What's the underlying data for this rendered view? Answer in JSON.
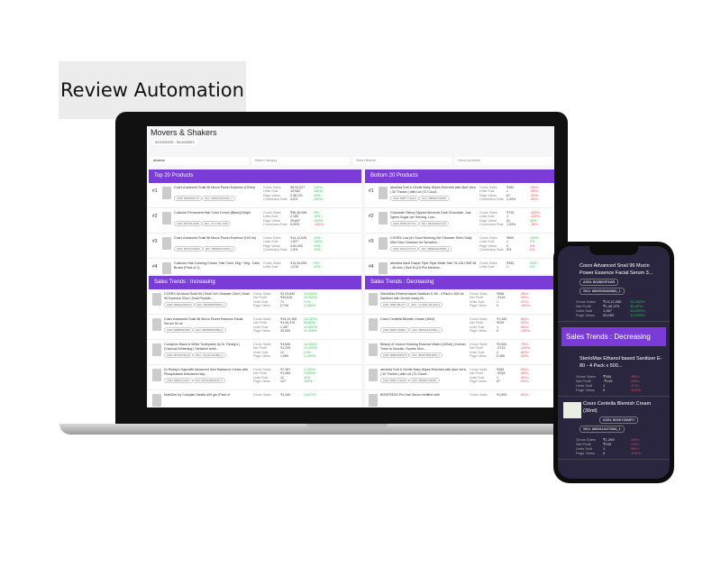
{
  "label": "Review Automation",
  "dashboard": {
    "title": "Movers & Shakers",
    "date_range": "02/10/2023 - 31/10/2023",
    "filters": [
      {
        "caption": "Select Marketplace",
        "value": "Amazon"
      },
      {
        "value": "Select Category"
      },
      {
        "value": "Select Brands"
      },
      {
        "value": "Search products"
      }
    ],
    "panels": [
      {
        "title": "Top 20 Products",
        "ranked": true,
        "rows": [
          {
            "rank": "#1",
            "name": "Cosrx Advanced Snail 96 Mucin Power Essence (100ml)",
            "asin": "ASIN: B00PBX3L7K",
            "sku": "SKU: 8809416470009_1",
            "metrics": [
              [
                "Gross Sales",
                "₹5,93,027",
                "100%↑",
                "up"
              ],
              [
                "Units Sold",
                "10,902",
                "100%↑",
                "up"
              ],
              [
                "Page Views",
                "2,38,101",
                "20%↑",
                "up"
              ],
              [
                "Conversion Rate",
                "4.5%",
                "100%↑",
                "up"
              ]
            ]
          },
          {
            "rank": "#2",
            "name": "Cuticolor Permanent Hair Color Cream (Black)100gm",
            "asin": "ASIN: B07K5L3P46",
            "sku": "SKU: VT-A7SE-Y5PT",
            "metrics": [
              [
                "Gross Sales",
                "₹36,46,998",
                "9%↑",
                "up"
              ],
              [
                "Units Sold",
                "2,169",
                "10%↑",
                "up"
              ],
              [
                "Page Views",
                "39,607",
                "100%↑",
                "up"
              ],
              [
                "Conversion Rate",
                "5.05%",
                "-100%↓",
                "dn"
              ]
            ]
          },
          {
            "rank": "#3",
            "name": "Cosrx Advanced Snail 96 Mucin Power Essence (100 ml)",
            "asin": "ASIN: B07K1G4RD9",
            "sku": "SKU: 8809416470009_1",
            "metrics": [
              [
                "Gross Sales",
                "₹14,12,626",
                "10%↑",
                "up"
              ],
              [
                "Units Sold",
                "1,627",
                "100%↑",
                "up"
              ],
              [
                "Page Views",
                "4,00,000",
                "10%↑",
                "up"
              ],
              [
                "Conversion Rate",
                "1.5%",
                "10%↑",
                "up"
              ]
            ]
          },
          {
            "rank": "#4",
            "name": "Cuticolor Hair Coloring Cream, Hair Color, 60g + 60g - Dark Brown (Pack of 1)",
            "asin": "",
            "sku": "",
            "metrics": [
              [
                "Gross Sales",
                "₹14,34,695",
                "2%↑",
                "up"
              ],
              [
                "Units Sold",
                "1,216",
                "10%↑",
                "up"
              ]
            ]
          }
        ]
      },
      {
        "title": "Bottom 20 Products",
        "ranked": true,
        "rows": [
          {
            "rank": "#1",
            "name": "abrorbia Soft & Gentle Baby Wipes Enriched with Aloe Vera | 3X Thicker | with Lid (72 Count...",
            "asin": "ASIN: B08TYC1HKC",
            "sku": "SKU: 8809537006361",
            "metrics": [
              [
                "Gross Sales",
                "₹450",
                "-99%↓",
                "dn"
              ],
              [
                "Units Sold",
                "1",
                "-99%↓",
                "dn"
              ],
              [
                "Page Views",
                "67",
                "-93%↓",
                "dn"
              ],
              [
                "Conversion Rate",
                "1.49%",
                "-99%↓",
                "dn"
              ]
            ]
          },
          {
            "rank": "#2",
            "name": "Chocolate Skinny Dipped Almonds Dark Chocolate, Just 2grms Sugar per Serving, Low...",
            "asin": "ASIN: B09FCP7V9G",
            "sku": "SKU: 8904400157247",
            "metrics": [
              [
                "Gross Sales",
                "₹725",
                "-100%↓",
                "dn"
              ],
              [
                "Units Sold",
                "1",
                "-100%↓",
                "dn"
              ],
              [
                "Page Views",
                "61",
                "50%↑",
                "up"
              ],
              [
                "Conversion Rate",
                "1.63%",
                "-78%↓",
                "dn"
              ]
            ]
          },
          {
            "rank": "#3",
            "name": "COSRX Low pH Good Morning Gel Cleanser 50ml, Daily Mild Face Cleanser for Sensitive...",
            "asin": "ASIN: B01CS7Y9YA",
            "sku": "SKU: 8809416470528_1",
            "metrics": [
              [
                "Gross Sales",
                "₹600",
                "100%↑",
                "up"
              ],
              [
                "Units Sold",
                "1",
                "0%",
                "up"
              ],
              [
                "Page Views",
                "0",
                "0%",
                "dn"
              ],
              [
                "Conversion Rate",
                "0%",
                "0%",
                "dn"
              ]
            ]
          },
          {
            "rank": "#4",
            "name": "abrorbia Adult Diaper Tape Style Waist Size 75-115 CMS 28 - 46 inns | Size M (10 Pcs Medium...",
            "asin": "",
            "sku": "",
            "metrics": [
              [
                "Gross Sales",
                "₹363",
                "25%↑",
                "up"
              ],
              [
                "Units Sold",
                "1",
                "0%",
                "up"
              ]
            ]
          }
        ]
      },
      {
        "title": "Sales Trends : Increasing",
        "ranked": false,
        "rows": [
          {
            "name": "COSRX All About Snail Kit | Snail Gel Cleanser 20ml | Snail 96 Essence 30ml | Snail Peptide...",
            "asin": "ASIN: B08QHMWF3Q",
            "sku": "SKU: 8809598452800_1",
            "metrics": [
              [
                "Gross Sales",
                "₹2,33,640",
                "10,000%↑",
                "up"
              ],
              [
                "Net Profit",
                "₹39,816",
                "10,000%↑",
                "up"
              ],
              [
                "Units Sold",
                "71",
                "71%↑",
                "up"
              ],
              [
                "Page Views",
                "2,749",
                "2,166%↑",
                "up"
              ]
            ]
          },
          {
            "name": "Cosrx Advanced Snail 96 Mucin Power Essence Facial Serum 30 ml",
            "asin": "ASIN: B00B5SP4W5",
            "sku": "SKU: 8809598453580_1",
            "metrics": [
              [
                "Gross Sales",
                "₹15,12,455",
                "15,232%↑",
                "up"
              ],
              [
                "Net Profit",
                "₹1,40,375",
                "95.82%↑",
                "up"
              ],
              [
                "Units Sold",
                "1,387",
                "10,000%↑",
                "up"
              ],
              [
                "Page Views",
                "30,053",
                "11,009%↑",
                "up"
              ]
            ]
          },
          {
            "name": "Cunaprox Black Is White Toothpaste by Dr. Reddy's | Charcoal Whitening | Sensitive teeth...",
            "asin": "ASIN: B07SFG8QJH",
            "sku": "SKU: 7612412431802_1",
            "metrics": [
              [
                "Gross Sales",
                "₹3,690",
                "14,400%↑",
                "up"
              ],
              [
                "Net Profit",
                "₹1,209",
                "12,400%↑",
                "up"
              ],
              [
                "Units Sold",
                "12",
                "12%↑",
                "up"
              ],
              [
                "Page Views",
                "1,069",
                "1,100%↑",
                "up"
              ]
            ]
          },
          {
            "name": "Dr Reddy's Daprolife Advanced Skin Radiance Cream with Phosphatase Activators help...",
            "asin": "ASIN: B08F3CCZ6V",
            "sku": "SKU: 8901148030013_1",
            "metrics": [
              [
                "Gross Sales",
                "₹7,387",
                "1,100%↑",
                "up"
              ],
              [
                "Net Profit",
                "₹1,069",
                "2,000%↑",
                "up"
              ],
              [
                "Units Sold",
                "12",
                "11%↑",
                "up"
              ],
              [
                "Page Views",
                "107",
                "100%↑",
                "up"
              ]
            ]
          },
          {
            "name": "NutriGen by Compian Vanilla 400 gm (Pack of",
            "asin": "",
            "sku": "",
            "metrics": [
              [
                "Gross Sales",
                "₹3,440",
                "1,047%↑",
                "up"
              ]
            ]
          }
        ]
      },
      {
        "title": "Sales Trends : Decreasing",
        "ranked": false,
        "rows": [
          {
            "name": "SterloMax Ethanol based Sanitizer E-80 - 4 Pack x 500 ml Sanitizer with 2in1ee ready fill...",
            "asin": "ASIN: B08C7BHJ7Y",
            "sku": "SKU: VT-1800-000-500-4",
            "metrics": [
              [
                "Gross Sales",
                "₹556",
                "-98%↓",
                "dn"
              ],
              [
                "Net Profit",
                "-₹145",
                "-99%↓",
                "dn"
              ],
              [
                "Units Sold",
                "1",
                "-97%↓",
                "dn"
              ],
              [
                "Page Views",
                "0",
                "-100%↓",
                "dn"
              ]
            ]
          },
          {
            "name": "Cosrx Centella Blemish Cream (30ml)",
            "asin": "ASIN: B00KY00MRY",
            "sku": "SKU: 8809416470366_1",
            "metrics": [
              [
                "Gross Sales",
                "₹1,269",
                "-94%↓",
                "dn"
              ],
              [
                "Net Profit",
                "₹249",
                "-22%↓",
                "dn"
              ],
              [
                "Units Sold",
                "1",
                "-96%↓",
                "dn"
              ],
              [
                "Page Views",
                "0",
                "-100%↓",
                "dn"
              ]
            ]
          },
          {
            "name": "Beauty of Joseon Glowing Essence Water (100ml) | Korean Toner to Nourish, Soothe Skin...",
            "asin": "ASIN: B0B2SD6WT8",
            "sku": "SKU: 8809738316863_1",
            "metrics": [
              [
                "Gross Sales",
                "₹3,600",
                "-75%↓",
                "dn"
              ],
              [
                "Net Profit",
                "-₹743",
                "-100%↓",
                "dn"
              ],
              [
                "Units Sold",
                "2",
                "-80%↓",
                "dn"
              ],
              [
                "Page Views",
                "2,459",
                "-35%↓",
                "dn"
              ]
            ]
          },
          {
            "name": "abrorbia Soft & Gentle Baby Wipes Enriched with Aloe Vera | 3X Thicker | with Lid (72 Count...",
            "asin": "ASIN: B08TYC1HKC",
            "sku": "SKU: 8809537006361",
            "metrics": [
              [
                "Gross Sales",
                "₹365",
                "-99%↓",
                "dn"
              ],
              [
                "Net Profit",
                "-₹254",
                "-99%↓",
                "dn"
              ],
              [
                "Units Sold",
                "1",
                "-99%↓",
                "dn"
              ],
              [
                "Page Views",
                "67",
                "-93%↓",
                "dn"
              ]
            ]
          },
          {
            "name": "BONTRESS Pro Hair Serum fortified with",
            "asin": "",
            "sku": "",
            "metrics": [
              [
                "Gross Sales",
                "₹1,500",
                "-90%↓",
                "dn"
              ]
            ]
          }
        ]
      }
    ]
  },
  "phone": {
    "top_card": {
      "name": "Cosrx Advanced Snail 96 Mucin Power Essence Facial Serum 3...",
      "asin": "ASIN: B00B5SP4W5",
      "sku": "SKU: 8809598453580_1",
      "metrics": [
        [
          "Gross Sales",
          "₹15,12,455",
          "15,232%↑",
          "up"
        ],
        [
          "Net Profit",
          "₹1,40,375",
          "95.82%↑",
          "up"
        ],
        [
          "Units Sold",
          "1,387",
          "10,000%↑",
          "up"
        ],
        [
          "Page Views",
          "30,053",
          "11,009%↑",
          "up"
        ]
      ]
    },
    "section_title": "Sales Trends : Decreasing",
    "cards": [
      {
        "name": "SterloMax Ethanol based Sanitizer E-80 - 4 Pack x 500...",
        "asin": "",
        "sku": "",
        "metrics": [
          [
            "Gross Sales",
            "₹556",
            "-98%↓",
            "dn"
          ],
          [
            "Net Profit",
            "-₹145",
            "-99%↓",
            "dn"
          ],
          [
            "Units Sold",
            "1",
            "-97%↓",
            "dn"
          ],
          [
            "Page Views",
            "0",
            "-100%↓",
            "dn"
          ]
        ]
      },
      {
        "name": "Cosrx Centella Blemish Cream (30ml)",
        "asin": "ASIN: B00KY00MRY",
        "sku": "SKU: 8809416470366_1",
        "metrics": [
          [
            "Gross Sales",
            "₹1,269",
            "-94%↓",
            "dn"
          ],
          [
            "Net Profit",
            "₹249",
            "-22%↓",
            "dn"
          ],
          [
            "Units Sold",
            "1",
            "-96%↓",
            "dn"
          ],
          [
            "Page Views",
            "0",
            "-100%↓",
            "dn"
          ]
        ]
      }
    ]
  },
  "colors": {
    "accent": "#7a3bd6",
    "up": "#2fbf4f",
    "down": "#e5484d"
  }
}
